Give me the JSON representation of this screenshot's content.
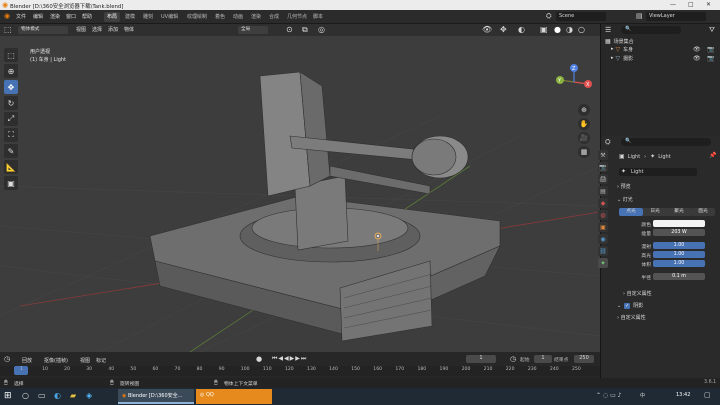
{
  "window": {
    "title": "Blender [D:\\360安全浏览器下载\\Tank.blend]",
    "min": "—",
    "max": "□",
    "close": "✕"
  },
  "menus": [
    "文件",
    "编辑",
    "渲染",
    "窗口",
    "帮助"
  ],
  "workspaces": [
    "布局",
    "建模",
    "雕刻",
    "UV编辑",
    "纹理绘制",
    "着色",
    "动画",
    "渲染",
    "合成",
    "几何节点",
    "脚本"
  ],
  "active_workspace_index": 0,
  "scene": {
    "label": "Scene"
  },
  "view_layer": {
    "label": "ViewLayer"
  },
  "viewport_header": {
    "mode": "物体模式",
    "menus": [
      "视图",
      "选择",
      "添加",
      "物体"
    ],
    "transform": "全局",
    "options": "选项",
    "coord": "坐标系",
    "default": "默认",
    "drag": "拖动",
    "select": "框选"
  },
  "viewport_info": {
    "line1": "用户透视",
    "line2": "(1) 车身 | Light"
  },
  "gizmo": {
    "x": "X",
    "y": "Y",
    "z": "Z"
  },
  "outliner": {
    "title": "场景集合",
    "items": [
      {
        "label": "车身",
        "icon": "mesh-icon"
      },
      {
        "label": "摄影",
        "icon": "camera-icon"
      }
    ]
  },
  "properties": {
    "object_name": "Light",
    "data_name": "Light",
    "datablock": "Light",
    "sections": {
      "preview": "预览",
      "light": "灯光",
      "custom_props": "自定义属性",
      "shadow": "阴影",
      "nodes": "自定义属性"
    },
    "light_types": [
      "点光",
      "日光",
      "聚光",
      "面光"
    ],
    "active_light_type": 0,
    "rows": [
      {
        "label": "颜色",
        "value": "",
        "kind": "white"
      },
      {
        "label": "能量",
        "value": "203 W",
        "kind": "grey"
      },
      {
        "label": "漫射",
        "value": "1.00",
        "kind": "blue"
      },
      {
        "label": "高光",
        "value": "1.00",
        "kind": "blue"
      },
      {
        "label": "体积",
        "value": "1.00",
        "kind": "blue"
      },
      {
        "label": "半径",
        "value": "0.1 m",
        "kind": "grey"
      }
    ],
    "shadow_checked": true
  },
  "timeline": {
    "menus": [
      "回放",
      "抠像(插帧)",
      "视图",
      "标记"
    ],
    "current_frame": "1",
    "start_label": "起始",
    "start": "1",
    "end_label": "结束点",
    "end": "250",
    "ticks": [
      "1",
      "10",
      "20",
      "30",
      "40",
      "50",
      "60",
      "70",
      "80",
      "90",
      "100",
      "110",
      "120",
      "130",
      "140",
      "150",
      "160",
      "170",
      "180",
      "190",
      "200",
      "210",
      "220",
      "230",
      "240",
      "250"
    ]
  },
  "status": {
    "left": "选择",
    "mid": "旋转视图",
    "right": "物体上下文菜单",
    "version": "3.6.1"
  },
  "taskbar": {
    "apps": [
      "Blender [D:\\360安全...",
      "QQ"
    ],
    "time": "13:42",
    "lang": "中"
  }
}
